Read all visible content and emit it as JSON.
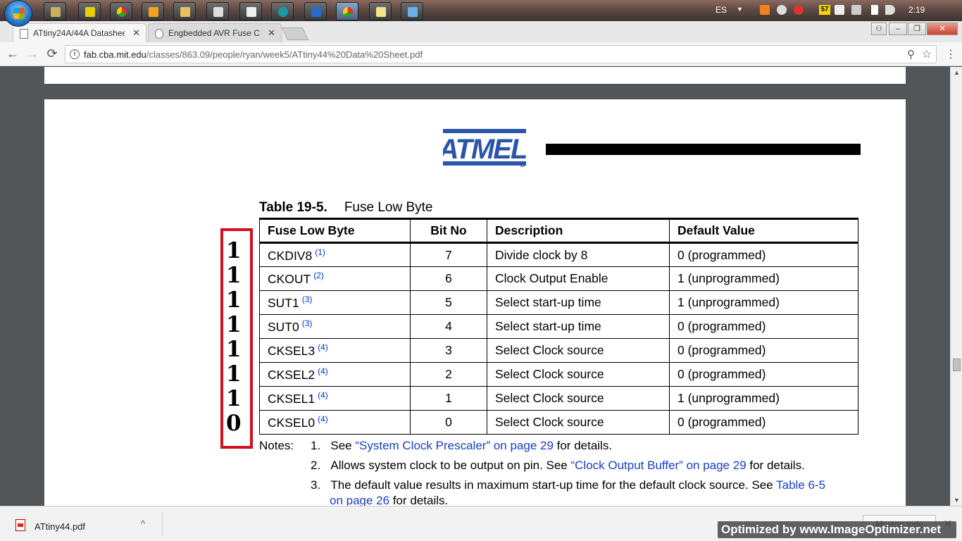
{
  "taskbar": {
    "language": "ES",
    "badge": "57",
    "clock": "2:19"
  },
  "tabs": [
    {
      "label": "ATtiny24A/44A Datashee",
      "active": true
    },
    {
      "label": "Engbedded AVR Fuse Ca",
      "active": false
    }
  ],
  "window_controls": {
    "minimize": "‒",
    "maximize": "❐",
    "close": "✕"
  },
  "toolbar": {
    "back": "←",
    "forward": "→",
    "reload": "⟳",
    "url_host": "fab.cba.mit.edu",
    "url_path": "/classes/863.09/people/ryan/week5/ATtiny44%20Data%20Sheet.pdf"
  },
  "document": {
    "table_number": "Table 19-5.",
    "table_name": "Fuse Low Byte",
    "columns": [
      "Fuse Low Byte",
      "Bit No",
      "Description",
      "Default Value"
    ],
    "rows": [
      {
        "fuse": "CKDIV8",
        "note": "(1)",
        "bit": "7",
        "desc": "Divide clock by 8",
        "default": "0 (programmed)"
      },
      {
        "fuse": "CKOUT",
        "note": "(2)",
        "bit": "6",
        "desc": "Clock Output Enable",
        "default": "1 (unprogrammed)"
      },
      {
        "fuse": "SUT1",
        "note": "(3)",
        "bit": "5",
        "desc": "Select start-up time",
        "default": "1 (unprogrammed)"
      },
      {
        "fuse": "SUT0",
        "note": "(3)",
        "bit": "4",
        "desc": "Select start-up time",
        "default": "0 (programmed)"
      },
      {
        "fuse": "CKSEL3",
        "note": "(4)",
        "bit": "3",
        "desc": "Select Clock source",
        "default": "0 (programmed)"
      },
      {
        "fuse": "CKSEL2",
        "note": "(4)",
        "bit": "2",
        "desc": "Select Clock source",
        "default": "0 (programmed)"
      },
      {
        "fuse": "CKSEL1",
        "note": "(4)",
        "bit": "1",
        "desc": "Select Clock source",
        "default": "1 (unprogrammed)"
      },
      {
        "fuse": "CKSEL0",
        "note": "(4)",
        "bit": "0",
        "desc": "Select Clock source",
        "default": "0 (programmed)"
      }
    ],
    "handwritten_bits": [
      "1",
      "1",
      "1",
      "1",
      "1",
      "1",
      "1",
      "0"
    ],
    "notes_label": "Notes:",
    "notes": [
      {
        "num": "1.",
        "pre": "See ",
        "link": "“System Clock Prescaler” on page 29",
        "post": " for details."
      },
      {
        "num": "2.",
        "pre": "Allows system clock to be output on pin. See ",
        "link": "“Clock Output Buffer” on page 29",
        "post": " for details."
      },
      {
        "num": "3.",
        "pre": "The default value results in maximum start-up time for the default clock source. See ",
        "link": "Table 6-5",
        "link2": "on page 26",
        "post": " for details."
      }
    ],
    "logo_text": "ATMEL"
  },
  "downloads": {
    "file_name": "ATtiny44.pdf",
    "show_all": "Mostrar todo"
  },
  "watermark": "Optimized by www.ImageOptimizer.net"
}
